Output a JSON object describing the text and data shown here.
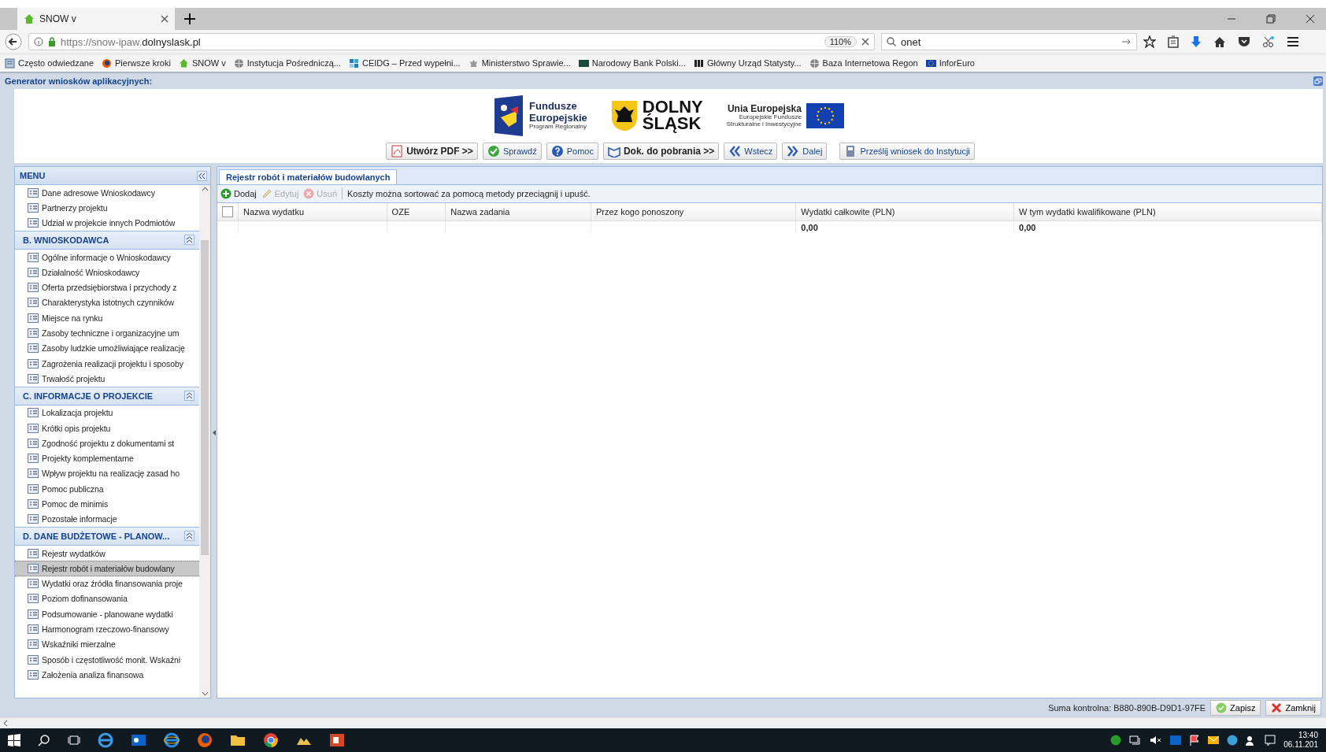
{
  "browser": {
    "tab": {
      "title": "SNOW v"
    },
    "url_scheme": "https://snow-ipaw.",
    "url_host": "dolnyslask.pl",
    "zoom": "110%",
    "search": {
      "value": "onet"
    },
    "bookmarks": [
      {
        "label": "Często odwiedzane",
        "kind": "pages"
      },
      {
        "label": "Pierwsze kroki",
        "kind": "browser"
      },
      {
        "label": "SNOW v",
        "kind": "house"
      },
      {
        "label": "Instytucja Pośredniczą...",
        "kind": "globe"
      },
      {
        "label": "CEIDG – Przed wypełni...",
        "kind": "tiles"
      },
      {
        "label": "Ministerstwo Sprawie...",
        "kind": "eagle"
      },
      {
        "label": "Narodowy Bank Polski...",
        "kind": "badge"
      },
      {
        "label": "Główny Urząd Statysty...",
        "kind": "mark"
      },
      {
        "label": "Baza Internetowa Regon",
        "kind": "globe"
      },
      {
        "label": "InforEuro",
        "kind": "flag"
      }
    ]
  },
  "app": {
    "title": "Generator wniosków aplikacyjnych:",
    "logos": {
      "fe_1": "Fundusze",
      "fe_2": "Europejskie",
      "fe_3": "Program Regionalny",
      "ds_1": "DOLNY",
      "ds_2": "ŚLĄSK",
      "ue_1": "Unia Europejska",
      "ue_2": "Europejskie Fundusze",
      "ue_3": "Strukturalne i Inwestycyjne"
    },
    "toolbar": [
      {
        "label": "Utwórz PDF >>",
        "kind": "pdf",
        "bold": true
      },
      {
        "label": "Sprawdź",
        "kind": "check",
        "bold": false
      },
      {
        "label": "Pomoc",
        "kind": "help",
        "bold": false
      },
      {
        "label": "Dok. do pobrania >>",
        "kind": "book",
        "bold": true
      },
      {
        "label": "Wstecz",
        "kind": "back",
        "bold": false
      },
      {
        "label": "Dalej",
        "kind": "next",
        "bold": false
      },
      {
        "label": "Prześlij wniosek do Instytucji",
        "kind": "send",
        "bold": false
      }
    ]
  },
  "sidebar": {
    "title": "MENU",
    "sections": [
      {
        "items": [
          {
            "label": "Dane adresowe Wnioskodawcy",
            "selected": false
          },
          {
            "label": "Partnerzy projektu",
            "selected": false
          },
          {
            "label": "Udział w projekcie innych Podmiotów",
            "selected": false
          }
        ]
      },
      {
        "title": "B. WNIOSKODAWCA",
        "items": [
          {
            "label": "Ogólne informacje o Wnioskodawcy",
            "selected": false
          },
          {
            "label": "Działalność Wnioskodawcy",
            "selected": false
          },
          {
            "label": "Oferta przedsiębiorstwa i przychody z",
            "selected": false
          },
          {
            "label": "Charakterystyka istotnych czynników",
            "selected": false
          },
          {
            "label": "Miejsce na rynku",
            "selected": false
          },
          {
            "label": "Zasoby techniczne i organizacyjne um",
            "selected": false
          },
          {
            "label": "Zasoby ludzkie umożliwiające realizację",
            "selected": false
          },
          {
            "label": "Zagrożenia realizacji projektu i sposoby",
            "selected": false
          },
          {
            "label": "Trwałość projektu",
            "selected": false
          }
        ]
      },
      {
        "title": "C. INFORMACJE O PROJEKCIE",
        "items": [
          {
            "label": "Lokalizacja projektu",
            "selected": false
          },
          {
            "label": "Krótki opis projektu",
            "selected": false
          },
          {
            "label": "Zgodność projektu z dokumentami st",
            "selected": false
          },
          {
            "label": "Projekty komplementarne",
            "selected": false
          },
          {
            "label": "Wpływ projektu na realizację zasad ho",
            "selected": false
          },
          {
            "label": "Pomoc publiczna",
            "selected": false
          },
          {
            "label": "Pomoc de minimis",
            "selected": false
          },
          {
            "label": "Pozostałe informacje",
            "selected": false
          }
        ]
      },
      {
        "title": "D. DANE BUDŻETOWE - PLANOW...",
        "items": [
          {
            "label": "Rejestr wydatków",
            "selected": false
          },
          {
            "label": "Rejestr robót i materiałów budowlany",
            "selected": true
          },
          {
            "label": "Wydatki oraz źródła finansowania proje",
            "selected": false
          },
          {
            "label": "Poziom dofinansowania",
            "selected": false
          },
          {
            "label": "Podsumowanie - planowane wydatki",
            "selected": false
          },
          {
            "label": "Harmonogram rzeczowo-finansowy",
            "selected": false
          },
          {
            "label": "Wskaźniki mierzalne",
            "selected": false
          },
          {
            "label": "Sposób i częstotliwość monit. Wskaźni",
            "selected": false
          },
          {
            "label": "Założenia analiza finansowa",
            "selected": false
          }
        ]
      }
    ]
  },
  "panel": {
    "tab": "Rejestr robót i materiałów budowlanych",
    "actions": [
      {
        "label": "Dodaj",
        "kind": "add",
        "disabled": false
      },
      {
        "label": "Edytuj",
        "kind": "edit",
        "disabled": true
      },
      {
        "label": "Usuń",
        "kind": "delete",
        "disabled": true
      }
    ],
    "select_all": {
      "checked": false
    },
    "hint": "Koszty można sortować za pomocą metody przeciągnij i upuść.",
    "columns": [
      {
        "label": "Nazwa wydatku"
      },
      {
        "label": "OZE"
      },
      {
        "label": "Nazwa zadania"
      },
      {
        "label": "Przez kogo ponoszony"
      },
      {
        "label": "Wydatki całkowite (PLN)",
        "total": "0,00"
      },
      {
        "label": "W tym wydatki kwalifikowane (PLN)",
        "total": "0,00"
      }
    ]
  },
  "status_bar": {
    "checksum": "Suma kontrolna: B880-890B-D9D1-97FE",
    "buttons": [
      {
        "label": "Zapisz",
        "kind": "save"
      },
      {
        "label": "Zamknij",
        "kind": "close"
      }
    ]
  },
  "taskbar": {
    "time": "13:40",
    "date": "06.11.201"
  }
}
